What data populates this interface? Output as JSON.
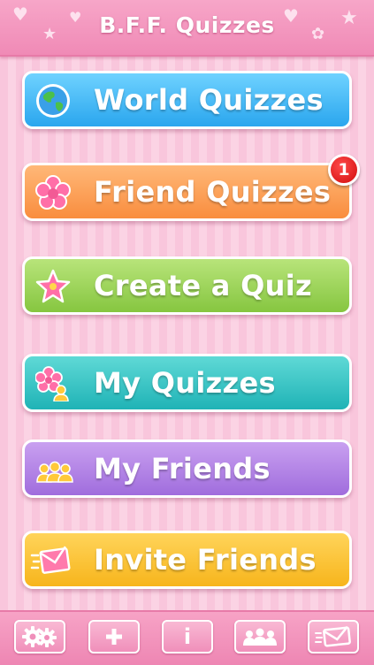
{
  "header": {
    "title": "B.F.F. Quizzes"
  },
  "menu": {
    "world_quizzes": "World Quizzes",
    "friend_quizzes": "Friend Quizzes",
    "friend_badge": "1",
    "create_quiz": "Create a Quiz",
    "my_quizzes": "My Quizzes",
    "my_friends": "My Friends",
    "invite_friends": "Invite Friends"
  },
  "toolbar": {
    "settings_icon": "gears-icon",
    "add_icon": "plus-icon",
    "info_label": "i",
    "friends_icon": "people-icon",
    "invite_icon": "envelope-icon"
  },
  "colors": {
    "header": "#f08ab6",
    "world": "#2aa6ee",
    "friend": "#f98d3e",
    "create": "#86c640",
    "my_quizzes": "#1fb3b6",
    "my_friends": "#a06ddd",
    "invite": "#f7b51c",
    "badge": "#d10c0c"
  }
}
